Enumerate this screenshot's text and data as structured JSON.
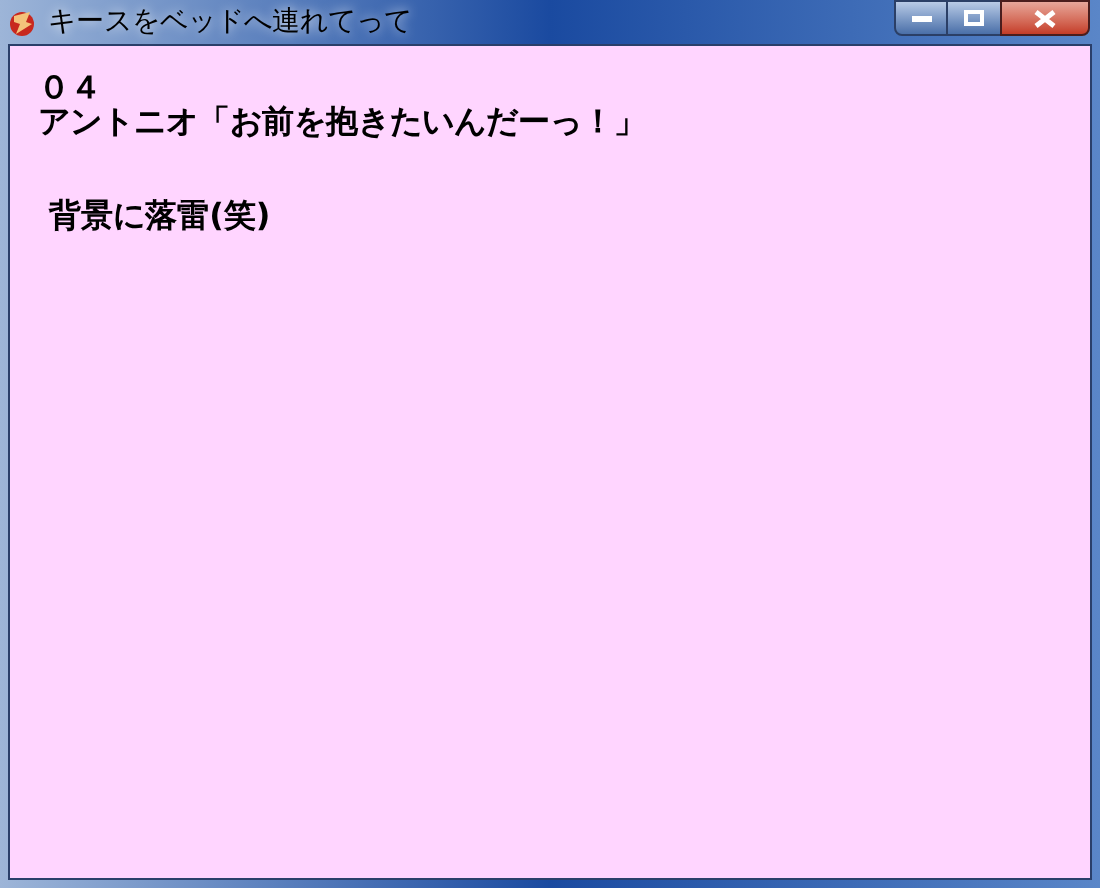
{
  "window": {
    "title": "キースをベッドへ連れてって"
  },
  "paragraphs": [
    [
      "０４",
      "アントニオ「お前を抱きたいんだーっ！」"
    ],
    [
      " 背景に落雷(笑)"
    ]
  ]
}
